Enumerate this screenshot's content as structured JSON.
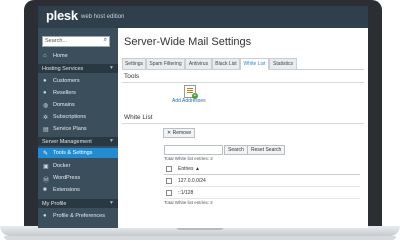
{
  "app": {
    "logo": "plesk",
    "edition": "web host edition"
  },
  "sidebar": {
    "search_placeholder": "Search...",
    "items": [
      {
        "label": "Home"
      },
      {
        "group": "Hosting Services"
      },
      {
        "label": "Customers"
      },
      {
        "label": "Resellers"
      },
      {
        "label": "Domains"
      },
      {
        "label": "Subscriptions"
      },
      {
        "label": "Service Plans"
      },
      {
        "group": "Server Management"
      },
      {
        "label": "Tools & Settings"
      },
      {
        "label": "Docker"
      },
      {
        "label": "WordPress"
      },
      {
        "label": "Extensions"
      },
      {
        "group": "My Profile"
      },
      {
        "label": "Profile & Preferences"
      }
    ]
  },
  "main": {
    "title": "Server-Wide Mail Settings",
    "tabs": [
      "Settings",
      "Spam Filtering",
      "Antivirus",
      "Black List",
      "White List",
      "Statistics"
    ],
    "active_tab": "White List",
    "tools_heading": "Tools",
    "add_addresses_label": "Add Addresses",
    "whitelist_heading": "White List",
    "remove_label": "Remove",
    "search_button": "Search",
    "reset_search_button": "Reset Search",
    "total_top": "Total White list entries: 2",
    "column_header": "Entries",
    "sort_indicator": "▲",
    "entries": [
      "127.0.0.0/24",
      "::1/128"
    ],
    "total_bottom": "Total White list entries: 2"
  },
  "colors": {
    "accent": "#1f8cd3",
    "sidebar": "#3b4e5c",
    "topbar": "#2f3f4c"
  }
}
